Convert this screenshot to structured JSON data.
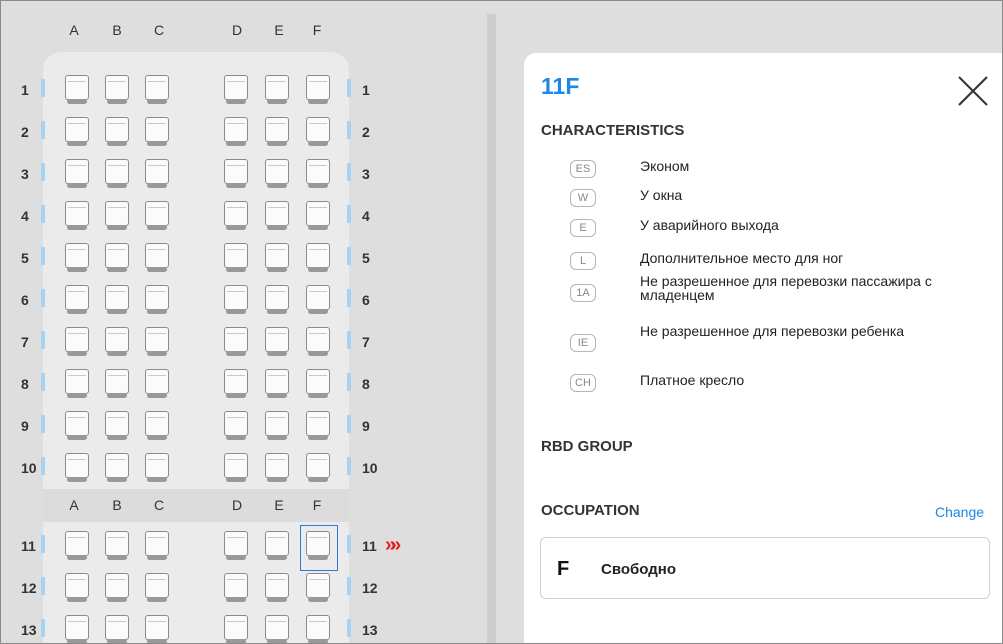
{
  "seat_map": {
    "columns_left": [
      "A",
      "B",
      "C"
    ],
    "columns_right": [
      "D",
      "E",
      "F"
    ],
    "rows": [
      "1",
      "2",
      "3",
      "4",
      "5",
      "6",
      "7",
      "8",
      "9",
      "10",
      "11",
      "12",
      "13"
    ],
    "selected_seat": "11F",
    "colors": {
      "exit_bar": "#a7d4f5",
      "selection": "#2b7bd6",
      "row_indicator": "#e02020"
    },
    "row_indicator_symbol": "»"
  },
  "detail": {
    "title": "11F",
    "close_icon": "close-icon",
    "characteristics_title": "CHARACTERISTICS",
    "characteristics": [
      {
        "code": "ES",
        "label": "Эконом"
      },
      {
        "code": "W",
        "label": "У окна"
      },
      {
        "code": "E",
        "label": "У аварийного выхода"
      },
      {
        "code": "L",
        "label": "Дополнительное место для ног"
      },
      {
        "code": "1A",
        "label": "Не разрешенное для перевозки пассажира с младенцем"
      },
      {
        "code": "IE",
        "label": "Не разрешенное для перевозки ребенка"
      },
      {
        "code": "CH",
        "label": "Платное кресло"
      }
    ],
    "rbd_group_title": "RBD GROUP",
    "occupation_title": "OCCUPATION",
    "change_label": "Change",
    "occupation": {
      "code": "F",
      "label": "Свободно"
    }
  }
}
